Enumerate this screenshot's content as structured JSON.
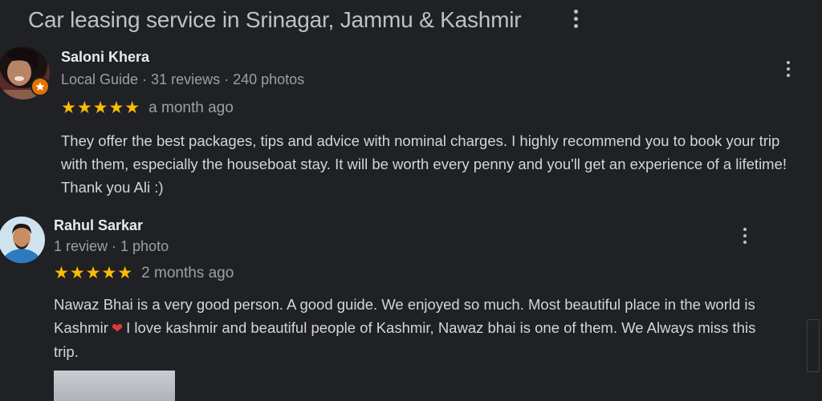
{
  "header": {
    "title": "Car leasing service in Srinagar, Jammu & Kashmir"
  },
  "icons": {
    "more": "kebab-vertical-icon",
    "local_guide_badge": "star-badge-icon",
    "heart": "red-heart-emoji"
  },
  "colors": {
    "background": "#202124",
    "star": "#fbbc04",
    "badge": "#e37400",
    "heart": "#e53935"
  },
  "reviews": [
    {
      "author": "Saloni Khera",
      "meta": "Local Guide · 31 reviews · 240 photos",
      "stars": "★★★★★",
      "rating": 5,
      "time": "a month ago",
      "text": "They offer the best packages, tips and advice with nominal charges. I highly recommend you to book your trip with them, especially the houseboat stay. It will be worth every penny and you'll get an experience of a lifetime! Thank you Ali :)"
    },
    {
      "author": "Rahul Sarkar",
      "meta": "1 review · 1 photo",
      "stars": "★★★★★",
      "rating": 5,
      "time": "2 months ago",
      "text_part1": "Nawaz Bhai is a very good person. A good guide. We enjoyed so much. Most beautiful place in the world is Kashmir",
      "text_part2": "I love kashmir and beautiful people of Kashmir, Nawaz bhai is one of them. We Always miss this trip."
    }
  ]
}
